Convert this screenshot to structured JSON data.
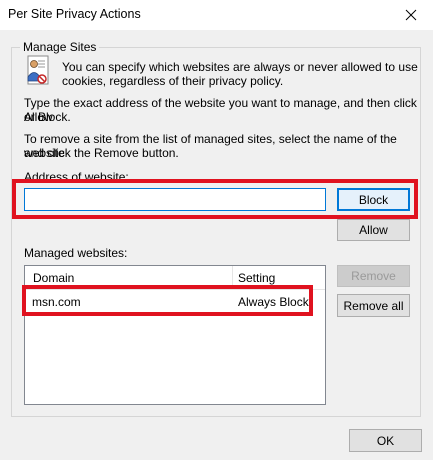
{
  "window": {
    "title": "Per Site Privacy Actions",
    "close_glyph": "✕"
  },
  "group": {
    "legend": "Manage Sites",
    "icon": "privacy-person-icon"
  },
  "text": {
    "intro_line1": "You can specify which websites are always or never allowed to use",
    "intro_line2": "cookies, regardless of their privacy policy.",
    "type_line1": "Type the exact address of the website you want to manage, and then click Allow",
    "type_line2": "or Block.",
    "remove_line1": "To remove a site from the list of managed sites, select the name of the website",
    "remove_line2": "and click the Remove button."
  },
  "address": {
    "label": "Address of website:",
    "value": "",
    "placeholder": ""
  },
  "buttons": {
    "block": "Block",
    "allow": "Allow",
    "remove": "Remove",
    "remove_all": "Remove all",
    "ok": "OK"
  },
  "managed": {
    "label": "Managed websites:",
    "columns": [
      "Domain",
      "Setting"
    ],
    "rows": [
      {
        "domain": "msn.com",
        "setting": "Always Block"
      }
    ]
  },
  "colors": {
    "highlight": "#e0121f",
    "focus_blue": "#0078d7",
    "dialog_bg": "#f0f0f0"
  }
}
